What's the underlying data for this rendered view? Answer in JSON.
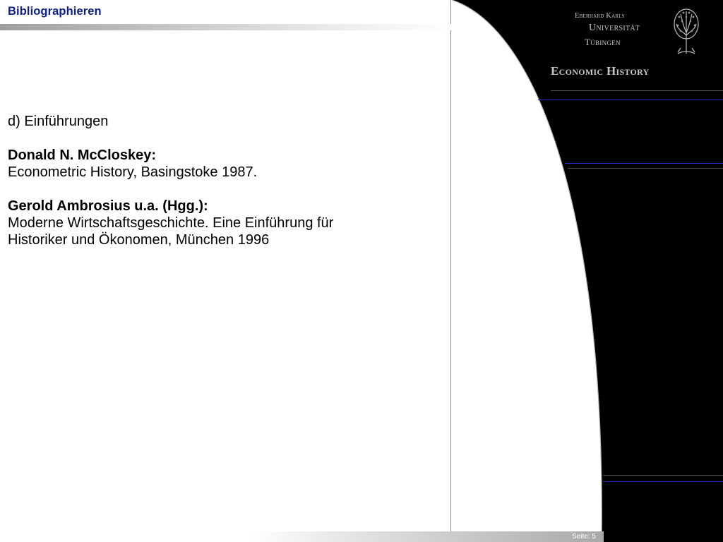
{
  "header": {
    "title": "Bibliographieren"
  },
  "content": {
    "section": "d) Einführungen",
    "entries": [
      {
        "author": "Donald N. McCloskey:",
        "lines": [
          "Econometric History, Basingstoke 1987."
        ]
      },
      {
        "author": "Gerold Ambrosius u.a. (Hgg.):",
        "lines": [
          "Moderne Wirtschaftsgeschichte. Eine Einführung für",
          "Historiker und Ökonomen, München 1996"
        ]
      }
    ]
  },
  "logo": {
    "line1": "Eberhard Karls",
    "line2": "Universität",
    "line3": "Tübingen",
    "icon": "tree-icon"
  },
  "sidebar": {
    "subtitle": "Economic History"
  },
  "footer": {
    "page": "Seite: 5"
  },
  "colors": {
    "title": "#0b1e8c",
    "panel": "#000000",
    "accent_line": "#2330b8",
    "logo_text": "#c8c8c8"
  }
}
